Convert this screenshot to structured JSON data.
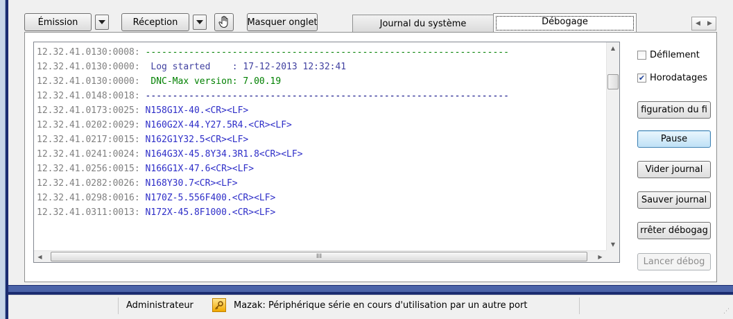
{
  "toolbar": {
    "emission_label": "Émission",
    "reception_label": "Réception",
    "hide_tab_label": "Masquer onglet"
  },
  "tabs": [
    {
      "label": "Journal du système",
      "active": false
    },
    {
      "label": "Débogage",
      "active": true
    }
  ],
  "log": {
    "lines": [
      {
        "ts": "12.32.41.0130:0008:",
        "text": " -------------------------------------------------------------------",
        "style": "dash"
      },
      {
        "ts": "12.32.41.0130:0000:",
        "text": "  Log started    : 17-12-2013 12:32:41",
        "style": "msg-dark"
      },
      {
        "ts": "12.32.41.0130:0000:",
        "text": "  DNC-Max version: 7.00.19",
        "style": "msg-green"
      },
      {
        "ts": "12.32.41.0148:0018:",
        "text": " -------------------------------------------------------------------",
        "style": "dash-blue"
      },
      {
        "ts": "12.32.41.0173:0025:",
        "text": " N158G1X-40.<CR><LF>",
        "style": "msg-blue"
      },
      {
        "ts": "12.32.41.0202:0029:",
        "text": " N160G2X-44.Y27.5R4.<CR><LF>",
        "style": "msg-blue"
      },
      {
        "ts": "12.32.41.0217:0015:",
        "text": " N162G1Y32.5<CR><LF>",
        "style": "msg-blue"
      },
      {
        "ts": "12.32.41.0241:0024:",
        "text": " N164G3X-45.8Y34.3R1.8<CR><LF>",
        "style": "msg-blue"
      },
      {
        "ts": "12.32.41.0256:0015:",
        "text": " N166G1X-47.6<CR><LF>",
        "style": "msg-blue"
      },
      {
        "ts": "12.32.41.0282:0026:",
        "text": " N168Y30.7<CR><LF>",
        "style": "msg-blue"
      },
      {
        "ts": "12.32.41.0298:0016:",
        "text": " N170Z-5.556F400.<CR><LF>",
        "style": "msg-blue"
      },
      {
        "ts": "12.32.41.0311:0013:",
        "text": " N172X-45.8F1000.<CR><LF>",
        "style": "msg-blue"
      }
    ],
    "hscroll_thumb_label": "III"
  },
  "options": {
    "scroll_label": "Défilement",
    "scroll_checked": false,
    "timestamps_label": "Horodatages",
    "timestamps_checked": true
  },
  "side_buttons": {
    "config": "figuration du fi",
    "pause": "Pause",
    "clear": "Vider journal",
    "save": "Sauver journal",
    "stop": "rrêter débogag",
    "start": "Lancer débog"
  },
  "status": {
    "user": "Administrateur",
    "message": "Mazak: Périphérique série en cours d'utilisation par un autre port"
  }
}
